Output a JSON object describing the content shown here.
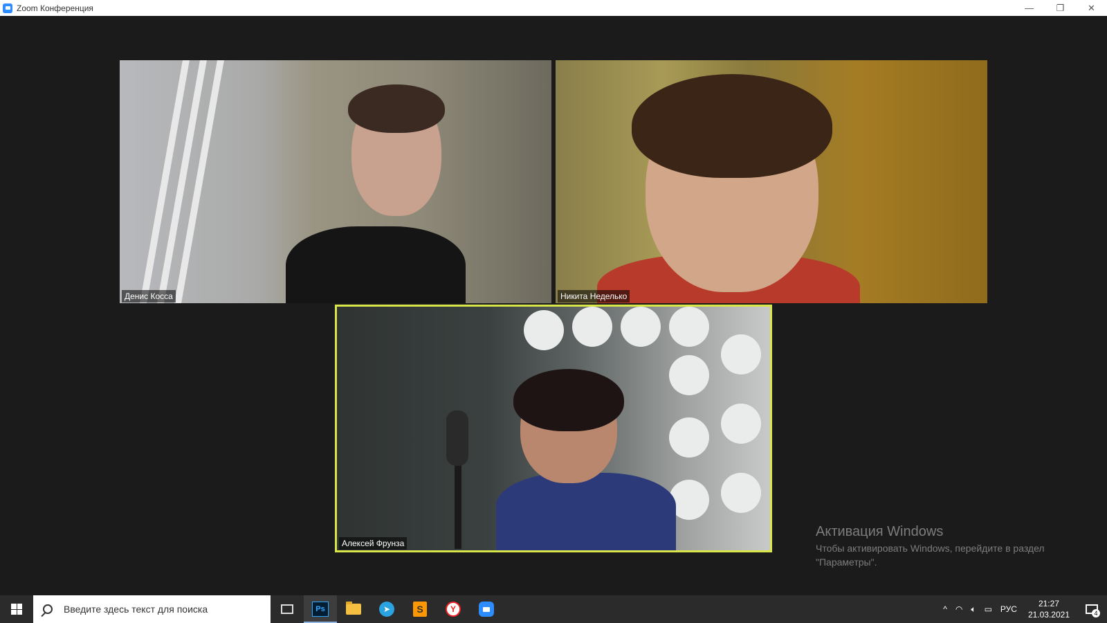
{
  "window": {
    "title": "Zoom Конференция",
    "minimize": "—",
    "restore": "❐",
    "close": "✕"
  },
  "participants": [
    {
      "name": "Денис Косса"
    },
    {
      "name": "Никита Неделько"
    },
    {
      "name": "Алексей Фрунза",
      "active_speaker": true
    }
  ],
  "watermark": {
    "title": "Активация Windows",
    "text": "Чтобы активировать Windows, перейдите в раздел \"Параметры\"."
  },
  "taskbar": {
    "search_placeholder": "Введите здесь текст для поиска",
    "apps": [
      "task-view",
      "photoshop",
      "file-explorer",
      "telegram",
      "sublime-text",
      "yandex-browser",
      "zoom"
    ],
    "photoshop_label": "Ps",
    "tray": {
      "chevron": "^",
      "language": "РУС",
      "time": "21:27",
      "date": "21.03.2021",
      "notifications_count": "4"
    }
  },
  "colors": {
    "active_speaker_border": "#d9e64a",
    "background": "#1b1b1b",
    "zoom_blue": "#2d8cff"
  }
}
